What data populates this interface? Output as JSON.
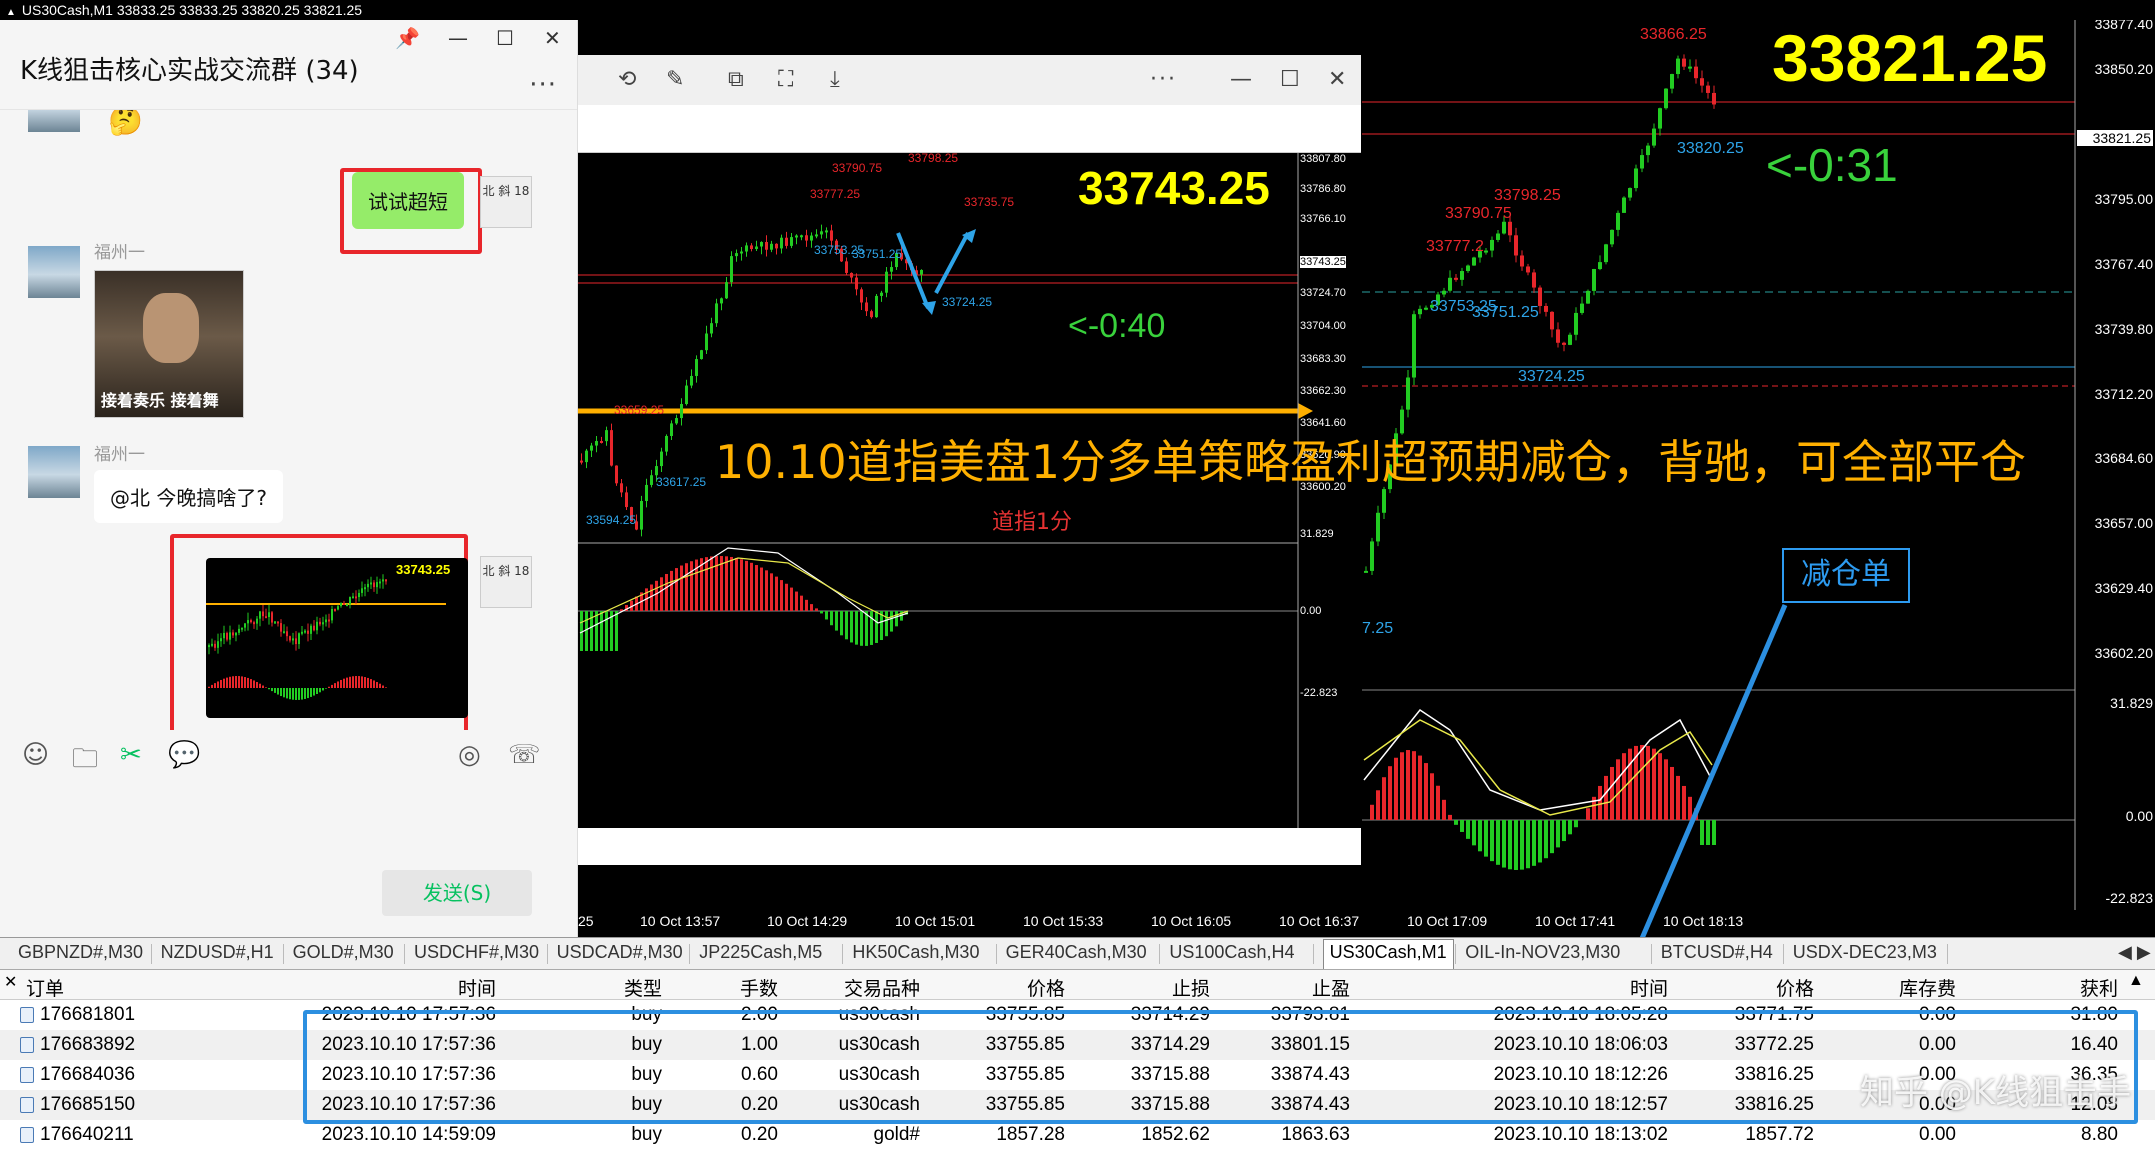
{
  "terminal": {
    "title_bar": "US30Cash,M1  33833.25 33833.25 33820.25 33821.25"
  },
  "main_chart": {
    "big_price": "33821.25",
    "countdown": "<-0:31",
    "bid_label": "33821.25",
    "annotations": {
      "high": "33866.25",
      "low_mark": "33820.25",
      "p33798": "33798.25",
      "p33790": "33790.75",
      "p33777": "33777.2",
      "p33753": "33753.25",
      "p33751": "33751.25",
      "p33724": "33724.25",
      "left_low": "7.25"
    },
    "price_axis": [
      "33877.40",
      "33850.20",
      "33821.25",
      "33795.00",
      "33767.40",
      "33739.80",
      "33712.20",
      "33684.60",
      "33657.00",
      "33629.40",
      "33602.20",
      "31.829",
      "0.00",
      "-22.823"
    ],
    "time_axis": [
      "25",
      "10 Oct 13:57",
      "10 Oct 14:29",
      "10 Oct 15:01",
      "10 Oct 15:33",
      "10 Oct 16:05",
      "10 Oct 16:37",
      "10 Oct 17:09",
      "10 Oct 17:41",
      "10 Oct 18:13"
    ],
    "strategy_text": "10.10道指美盘1分多单策略盈利超预期减仓，背驰，可全部平仓",
    "subtitle": "道指1分",
    "reduce_label": "减仓单"
  },
  "inner_chart": {
    "big_price": "33743.25",
    "countdown": "<-0:40",
    "annotations": [
      "33798.25",
      "33790.75",
      "33777.25",
      "33753.25",
      "33751.25",
      "33735.75",
      "33724.25",
      "33659.25",
      "33617.25",
      "33594.25"
    ],
    "price_axis": [
      "33807.80",
      "33786.80",
      "33766.10",
      "33743.25",
      "33724.70",
      "33704.00",
      "33683.30",
      "33662.30",
      "33641.60",
      "33620.90",
      "33600.20",
      "31.829",
      "0.00",
      "-22.823"
    ]
  },
  "wechat": {
    "title": "K线狙击核心实战交流群 (34)",
    "more": "···",
    "sender1": "福州一",
    "sender2": "福州一",
    "msg_out": "试试超短",
    "sticker_caption": "接着奏乐 接着舞",
    "msg_in": "@北        今晚搞啥了?",
    "thumb_price": "33743.25",
    "send_label": "发送(S)",
    "self_avatar": "北 斜 18"
  },
  "tabs": [
    "GBPNZD#,M30",
    "NZDUSD#,H1",
    "GOLD#,M30",
    "USDCHF#,M30",
    "USDCAD#,M30",
    "JP225Cash,M5",
    "HK50Cash,M30",
    "GER40Cash,M30",
    "US100Cash,H4",
    "US30Cash,M1",
    "OIL-In-NOV23,M30",
    "BTCUSD#,H4",
    "USDX-DEC23,M3"
  ],
  "active_tab": "US30Cash,M1",
  "trades": {
    "headers": [
      "订单",
      "时间",
      "类型",
      "手数",
      "交易品种",
      "价格",
      "止损",
      "止盈",
      "时间",
      "价格",
      "库存费",
      "获利"
    ],
    "rows": [
      [
        "176681801",
        "2023.10.10 17:57:36",
        "buy",
        "2.00",
        "us30cash",
        "33755.85",
        "33714.29",
        "33793.81",
        "2023.10.10 18:05:28",
        "33771.75",
        "0.00",
        "31.80"
      ],
      [
        "176683892",
        "2023.10.10 17:57:36",
        "buy",
        "1.00",
        "us30cash",
        "33755.85",
        "33714.29",
        "33801.15",
        "2023.10.10 18:06:03",
        "33772.25",
        "0.00",
        "16.40"
      ],
      [
        "176684036",
        "2023.10.10 17:57:36",
        "buy",
        "0.60",
        "us30cash",
        "33755.85",
        "33715.88",
        "33874.43",
        "2023.10.10 18:12:26",
        "33816.25",
        "0.00",
        "36.35"
      ],
      [
        "176685150",
        "2023.10.10 17:57:36",
        "buy",
        "0.20",
        "us30cash",
        "33755.85",
        "33715.88",
        "33874.43",
        "2023.10.10 18:12:57",
        "33816.25",
        "0.00",
        "12.08"
      ],
      [
        "176640211",
        "2023.10.10 14:59:09",
        "buy",
        "0.20",
        "gold#",
        "1857.28",
        "1852.62",
        "1863.63",
        "2023.10.10 18:13:02",
        "1857.72",
        "0.00",
        "8.80"
      ]
    ]
  },
  "watermark": "知乎 @K线狙击手",
  "colors": {
    "up": "#22cc22",
    "down": "#e8262b",
    "price_yellow": "#ffff00",
    "highlight_blue": "#2c8fe0",
    "wechat_green": "#95ec69"
  }
}
